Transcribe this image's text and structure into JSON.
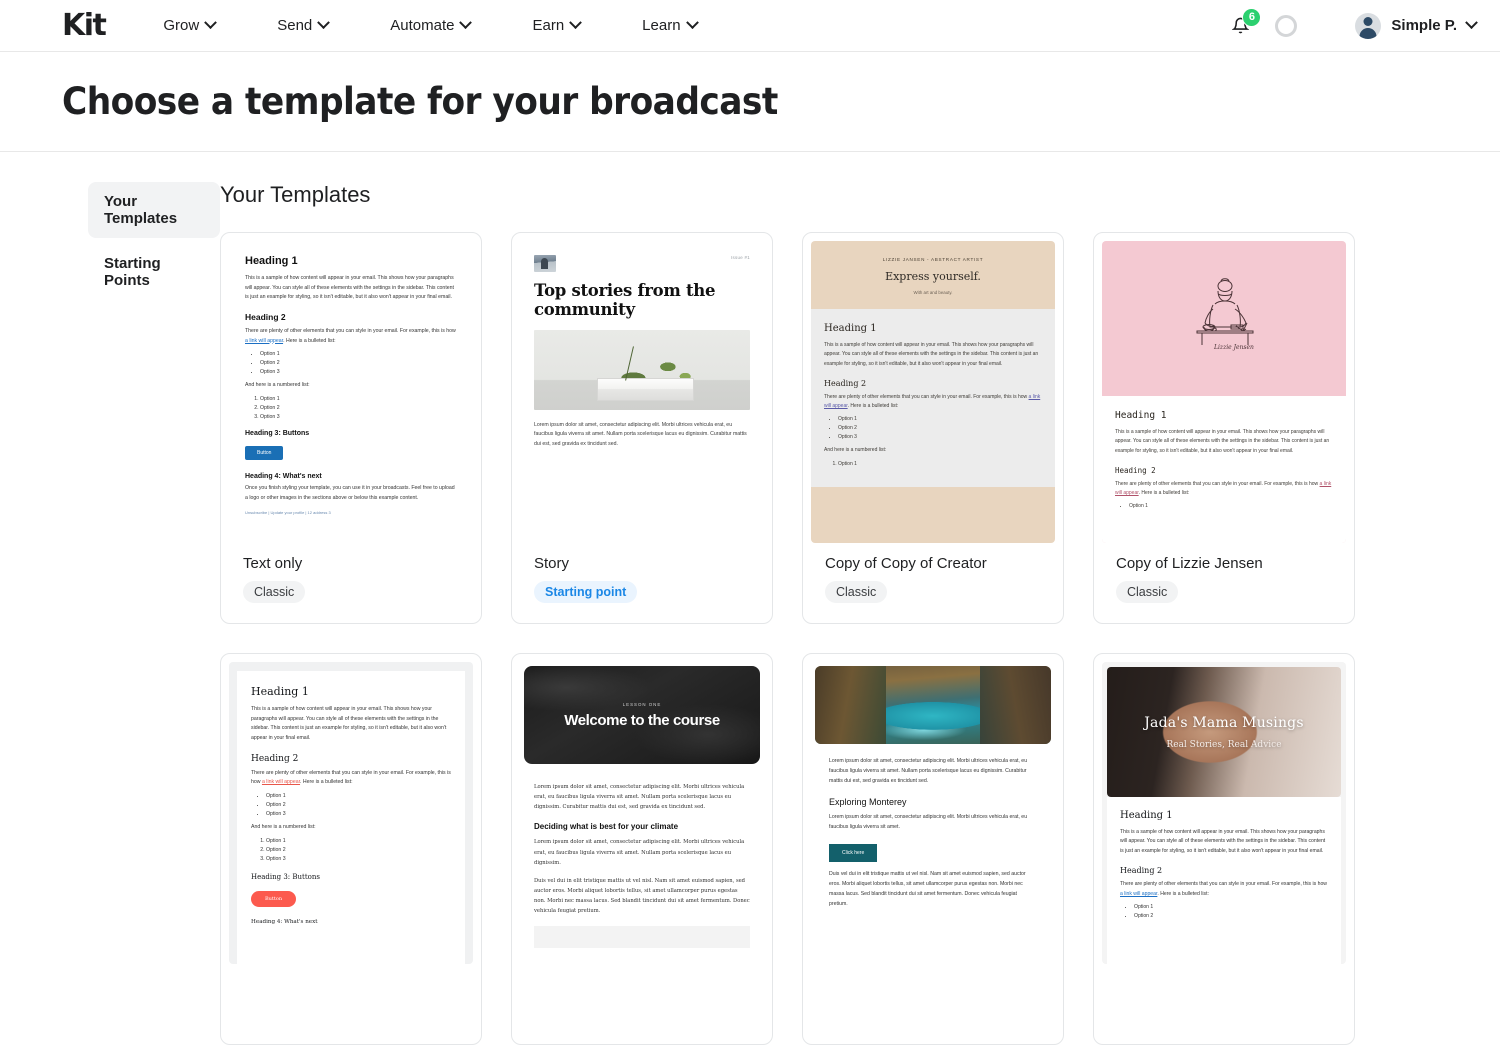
{
  "brand": {
    "logo": "Kit"
  },
  "nav": {
    "items": [
      {
        "label": "Grow"
      },
      {
        "label": "Send"
      },
      {
        "label": "Automate"
      },
      {
        "label": "Earn"
      },
      {
        "label": "Learn"
      }
    ],
    "notifications_count": "6",
    "profile_name": "Simple P."
  },
  "page": {
    "title": "Choose a template for your broadcast"
  },
  "sidebar": {
    "items": [
      {
        "label": "Your Templates",
        "active": true
      },
      {
        "label": "Starting Points",
        "active": false
      }
    ]
  },
  "main": {
    "section_title": "Your Templates",
    "cards": [
      {
        "name": "Text only",
        "badge": "Classic",
        "badge_type": "gray"
      },
      {
        "name": "Story",
        "badge": "Starting point",
        "badge_type": "blue"
      },
      {
        "name": "Copy of Copy of Creator",
        "badge": "Classic",
        "badge_type": "gray"
      },
      {
        "name": "Copy of Lizzie Jensen",
        "badge": "Classic",
        "badge_type": "gray"
      }
    ]
  },
  "previews": {
    "text_only": {
      "h1": "Heading 1",
      "p1": "This is a sample of how content will appear in your email. This shows how your paragraphs will appear. You can style all of these elements with the settings in the sidebar. This content is just an example for styling, so it isn't editable, but it also won't appear in your final email.",
      "h2": "Heading 2",
      "p2_pre": "There are plenty of other elements that you can style in your email. For example, this is how ",
      "link": "a link will appear",
      "p2_post": ". Here is a bulleted list:",
      "bullets": [
        "Option 1",
        "Option 2",
        "Option 3"
      ],
      "numbered_intro": "And here is a numbered list:",
      "numbered": [
        "Option 1",
        "Option 2",
        "Option 3"
      ],
      "h3": "Heading 3: Buttons",
      "button": "Button",
      "h4": "Heading 4: What's next",
      "p3": "Once you finish styling your template, you can use it in your broadcasts. Feel free to upload a logo or other images in the sections above or below this example content.",
      "footer": "Unsubscribe | Update your profile | 12 address 3"
    },
    "story": {
      "issue": "Issue #1",
      "h1": "Top stories from the community",
      "p": "Lorem ipsum dolor sit amet, consectetur adipiscing elit. Morbi ultrices vehicula erat, eu faucibus ligula viverra sit amet. Nullam porta scelerisque lacus eu dignissim. Curabitur mattis dui est, sed gravida ex tincidunt sed."
    },
    "creator": {
      "kicker": "LIZZIE JANSEN - ABSTRACT ARTIST",
      "title": "Express yourself.",
      "subtitle": "With art and beauty.",
      "h1": "Heading 1",
      "p1": "This is a sample of how content will appear in your email. This shows how your paragraphs will appear. You can style all of these elements with the settings in the sidebar. This content is just an example for styling, so it isn't editable, but it also won't appear in your final email.",
      "h2": "Heading 2",
      "p2_pre": "There are plenty of other elements that you can style in your email. For example, this is how ",
      "link": "a link will appear",
      "p2_post": ". Here is a bulleted list:",
      "bullets": [
        "Option 1",
        "Option 2",
        "Option 3"
      ],
      "numbered_intro": "And here is a numbered list:",
      "numbered": [
        "Option 1"
      ]
    },
    "lizzie": {
      "signature": "Lizzie Jensen",
      "h1": "Heading 1",
      "p1": "This is a sample of how content will appear in your email. This shows how your paragraphs will appear. You can style all of these elements with the settings in the sidebar. This content is just an example for styling, so it isn't editable, but it also won't appear in your final email.",
      "h2": "Heading 2",
      "p2_pre": "There are plenty of other elements that you can style in your email. For example, this is how ",
      "link": "a link will appear",
      "p2_post": ". Here is a bulleted list:",
      "bullets": [
        "Option 1"
      ]
    },
    "serif": {
      "h1": "Heading 1",
      "p1": "This is a sample of how content will appear in your email. This shows how your paragraphs will appear. You can style all of these elements with the settings in the sidebar. This content is just an example for styling, so it isn't editable, but it also won't appear in your final email.",
      "h2": "Heading 2",
      "p2_pre": "There are plenty of other elements that you can style in your email. For example, this is how ",
      "link": "a link will appear",
      "p2_post": ". Here is a bulleted list:",
      "bullets": [
        "Option 1",
        "Option 2",
        "Option 3"
      ],
      "numbered_intro": "And here is a numbered list:",
      "numbered": [
        "Option 1",
        "Option 2",
        "Option 3"
      ],
      "h3": "Heading 3: Buttons",
      "button": "Button",
      "h4": "Heading 4: What's next"
    },
    "course": {
      "kicker": "LESSON ONE",
      "h1": "Welcome to the course",
      "p1": "Lorem ipsum dolor sit amet, consectetur adipiscing elit. Morbi ultrices vehicula erat, eu faucibus ligula viverra sit amet. Nullam porta scelerisque lacus eu dignissim. Curabitur mattis dui est, sed gravida ex tincidunt sed.",
      "h2": "Deciding what is best for your climate",
      "p2": "Lorem ipsum dolor sit amet, consectetur adipiscing elit. Morbi ultrices vehicula erat, eu faucibus ligula viverra sit amet. Nullam porta scelerisque lacus eu dignissim.",
      "p3": "Duis vel dui in elit tristique mattis ut vel nisl. Nam sit amet euismod sapien, sed auctor eros. Morbi aliquet lobortis tellus, sit amet ullamcorper purus egestas non. Morbi nec massa lacus. Sed blandit tincidunt dui sit amet fermentum. Donec vehicula feugiat pretium."
    },
    "monterey": {
      "p1": "Lorem ipsum dolor sit amet, consectetur adipiscing elit. Morbi ultrices vehicula erat, eu faucibus ligula viverra sit amet. Nullam porta scelerisque lacus eu dignissim. Curabitur mattis dui est, sed gravida ex tincidunt sed.",
      "h2": "Exploring Monterey",
      "p2": "Lorem ipsum dolor sit amet, consectetur adipiscing elit. Morbi ultrices vehicula erat, eu faucibus ligula viverra sit amet.",
      "button": "Click here",
      "p3": "Duis vel dui in elit tristique mattis ut vel nisl. Nam sit amet euismod sapien, sed auctor eros. Morbi aliquet lobortis tellus, sit amet ullamcorper purus egestas non. Morbi nec massa lacus. Sed blandit tincidunt dui sit amet fermentum. Donec vehicula feugiat pretium."
    },
    "jada": {
      "title": "Jada's Mama Musings",
      "subtitle": "Real Stories, Real Advice",
      "h1": "Heading 1",
      "p1": "This is a sample of how content will appear in your email. This shows how your paragraphs will appear. You can style all of these elements with the settings in the sidebar. This content is just an example for styling, so it isn't editable, but it also won't appear in your final email.",
      "h2": "Heading 2",
      "p2_pre": "There are plenty of other elements that you can style in your email. For example, this is how ",
      "link": "a link will appear",
      "p2_post": ". Here is a bulleted list:",
      "bullets": [
        "Option 1",
        "Option 2"
      ]
    }
  },
  "colors": {
    "accent_blue": "#1b87e6",
    "badge_green": "#2cd06f",
    "chip_gray": "#f2f3f4",
    "creator_beige": "#e8d5bf",
    "lizzie_pink": "#f4c9d2",
    "button_blue": "#1a6fb5",
    "button_red": "#fc5a4e",
    "button_teal": "#13606b"
  }
}
